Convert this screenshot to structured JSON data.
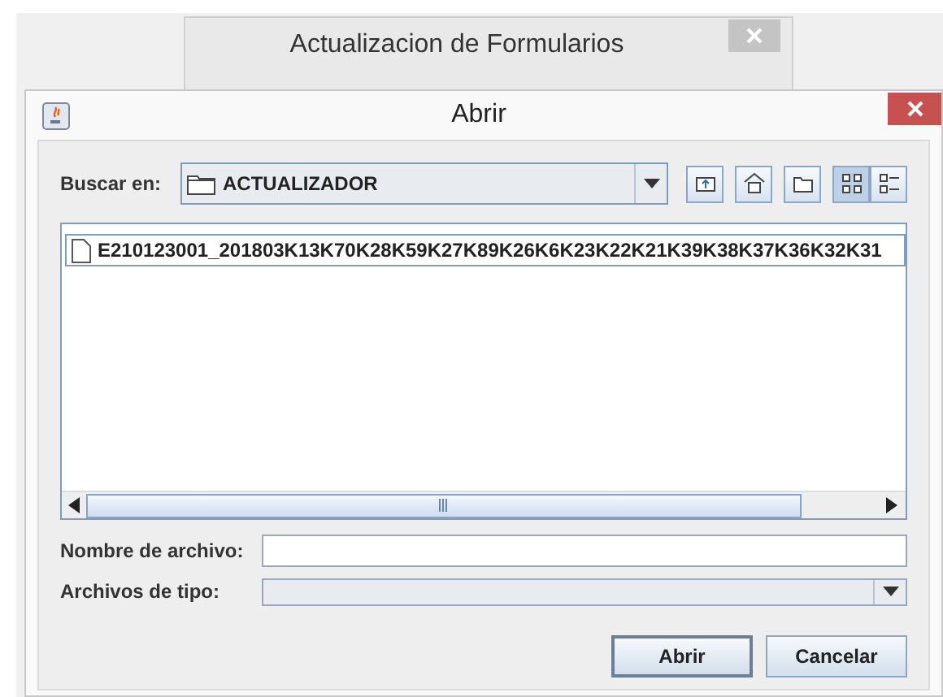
{
  "background_window": {
    "title": "Actualizacion de Formularios"
  },
  "dialog": {
    "title": "Abrir"
  },
  "look_in": {
    "label": "Buscar en:",
    "value": "ACTUALIZADOR"
  },
  "toolbar": [
    {
      "kind": "up",
      "selected": false
    },
    {
      "kind": "home",
      "selected": false
    },
    {
      "kind": "new-folder",
      "selected": false
    },
    {
      "kind": "list",
      "selected": true
    },
    {
      "kind": "details",
      "selected": false
    }
  ],
  "files": [
    {
      "name": "E210123001_201803K13K70K28K59K27K89K26K6K23K22K21K39K38K37K36K32K31"
    }
  ],
  "file_name": {
    "label": "Nombre de archivo:"
  },
  "file_type": {
    "label": "Archivos de tipo:"
  },
  "buttons": [
    {
      "label": "Abrir",
      "default": true
    },
    {
      "label": "Cancelar",
      "default": false
    }
  ]
}
